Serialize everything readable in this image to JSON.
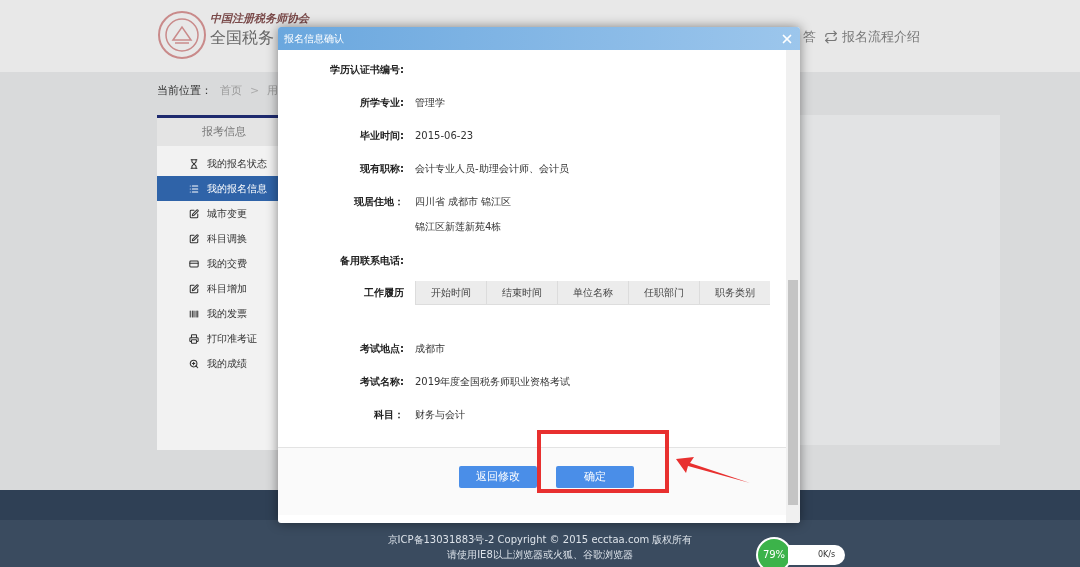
{
  "header": {
    "logo_calligraphy": "中国注册税务师协会",
    "logo_title": "全国税务",
    "nav": [
      "答",
      "报名流程介绍"
    ]
  },
  "breadcrumb": {
    "label": "当前位置：",
    "separator": ">",
    "items": [
      "首页",
      "用"
    ]
  },
  "sidebar": {
    "title": "报考信息",
    "items": [
      {
        "label": "我的报名状态",
        "selected": false
      },
      {
        "label": "我的报名信息",
        "selected": true
      },
      {
        "label": "城市变更",
        "selected": false
      },
      {
        "label": "科目调换",
        "selected": false
      },
      {
        "label": "我的交费",
        "selected": false
      },
      {
        "label": "科目增加",
        "selected": false
      },
      {
        "label": "我的发票",
        "selected": false
      },
      {
        "label": "打印准考证",
        "selected": false
      },
      {
        "label": "我的成绩",
        "selected": false
      }
    ]
  },
  "dialog": {
    "title": "报名信息确认",
    "fields": [
      {
        "label": "学历认证书编号:"
      },
      {
        "label": "所学专业:",
        "values": [
          "管理学"
        ]
      },
      {
        "label": "毕业时间:",
        "values": [
          "2015-06-23"
        ]
      },
      {
        "label": "现有职称:",
        "values": [
          "会计专业人员-助理会计师、会计员"
        ]
      },
      {
        "label": "现居住地：",
        "values": [
          "四川省 成都市 锦江区",
          "锦江区新莲新苑4栋"
        ]
      },
      {
        "label": "备用联系电话:"
      }
    ],
    "work_history": {
      "label": "工作履历",
      "columns": [
        "开始时间",
        "结束时间",
        "单位名称",
        "任职部门",
        "职务类别"
      ]
    },
    "exam_fields": [
      {
        "label": "考试地点:",
        "value": "成都市"
      },
      {
        "label": "考试名称:",
        "value": "2019年度全国税务师职业资格考试"
      },
      {
        "label": "科目：",
        "value": "财务与会计"
      }
    ],
    "buttons": [
      {
        "label": "返回修改",
        "highlighted": false
      },
      {
        "label": "确定",
        "highlighted": true
      }
    ]
  },
  "footer": {
    "lines": [
      "京ICP备13031883号-2 Copyright © 2015 ecctaa.com 版权所有",
      "请使用IE8以上浏览器或火狐、谷歌浏览器"
    ]
  },
  "speed_widget": {
    "percent": "79%",
    "speed": "0K/s"
  }
}
